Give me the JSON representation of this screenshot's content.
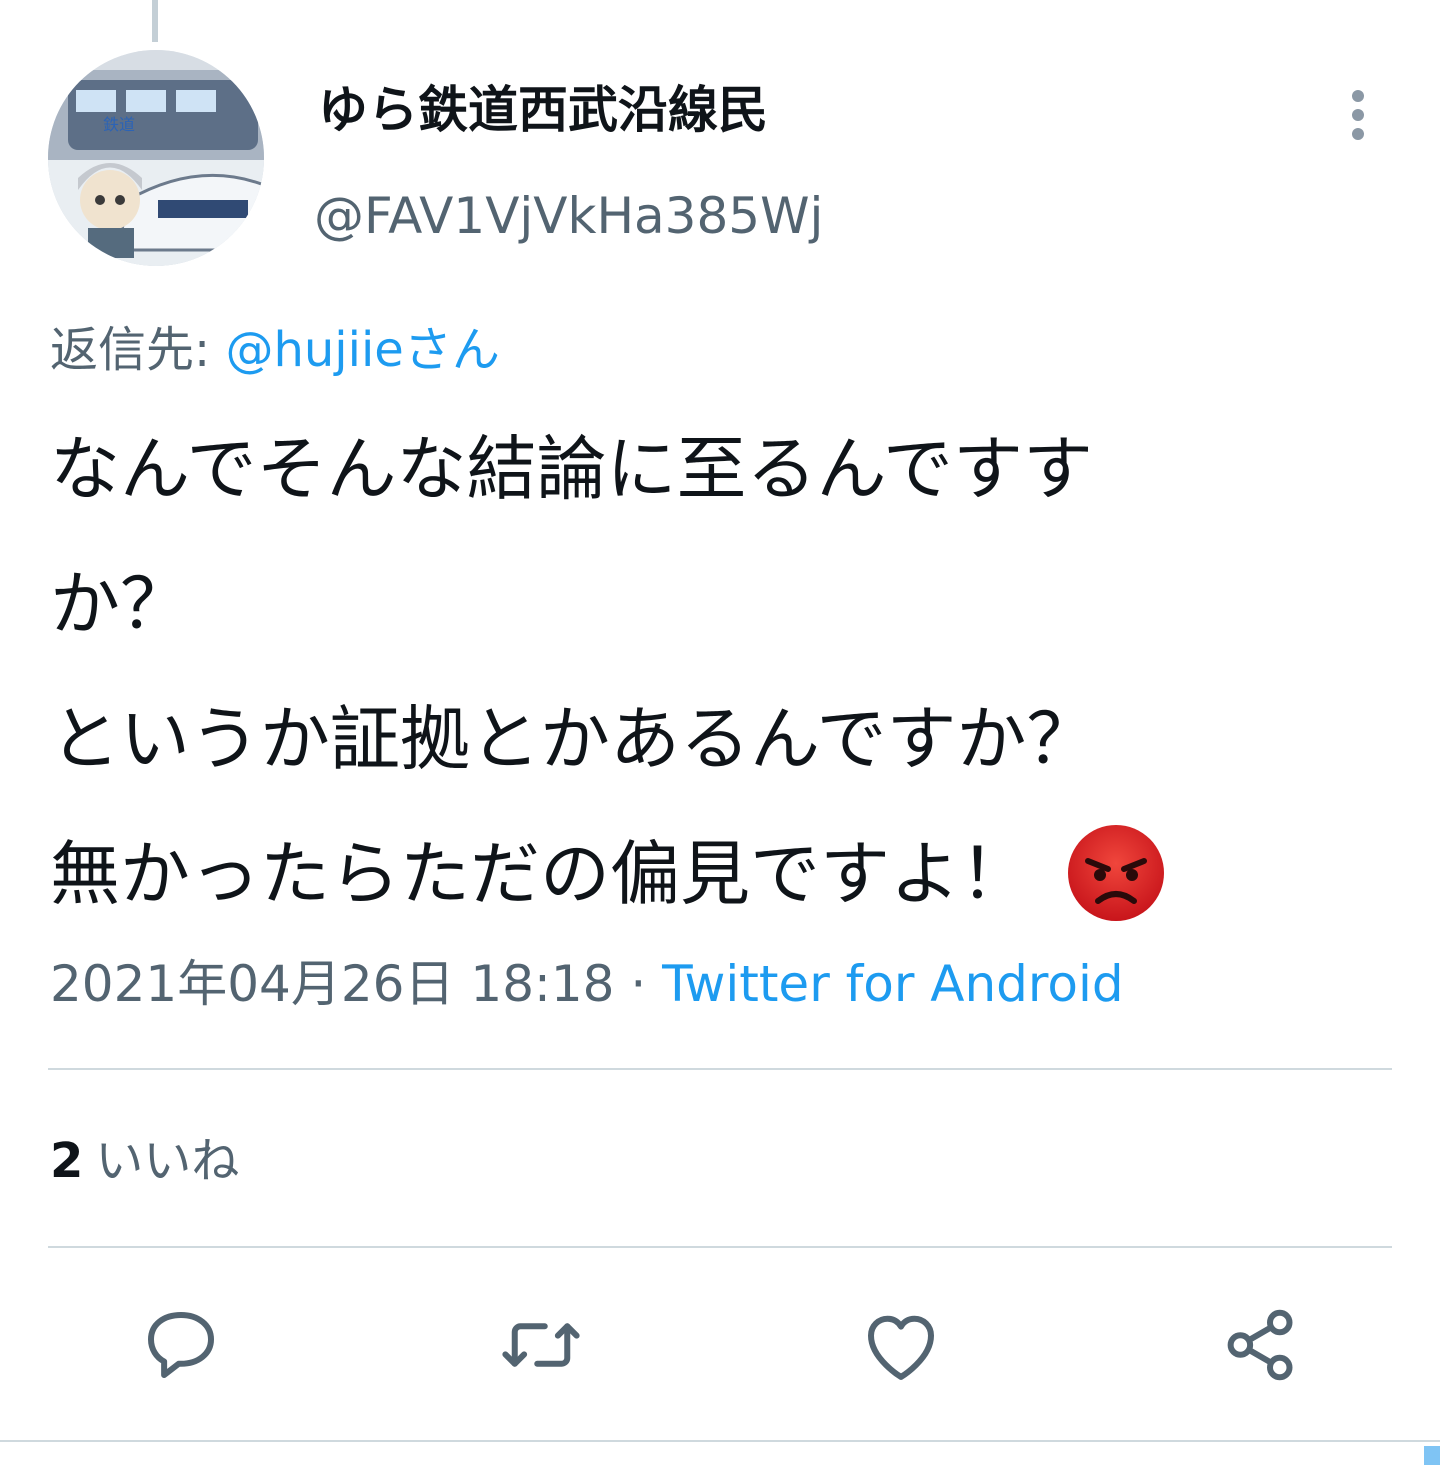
{
  "author": {
    "display_name": "ゆら鉄道西武沿線民",
    "handle": "@FAV1VjVkHa385Wj"
  },
  "reply": {
    "prefix": "返信先: ",
    "mention": "@hujiieさん"
  },
  "tweet": {
    "lines": [
      "なんでそんな結論に至るんですす",
      "か？",
      "というか証拠とかあるんですか？",
      "無かったらただの偏見ですよ！"
    ],
    "emoji": "angry-face"
  },
  "meta": {
    "timestamp": "2021年04月26日 18:18",
    "separator": " · ",
    "source": "Twitter for Android"
  },
  "engagement": {
    "likes_count": "2",
    "likes_label": "いいね"
  },
  "actions": [
    "reply",
    "retweet",
    "like",
    "share"
  ],
  "colors": {
    "accent": "#1d9bf0",
    "secondary_text": "#536471",
    "icon": "#536471",
    "divider": "#cfd9de"
  }
}
